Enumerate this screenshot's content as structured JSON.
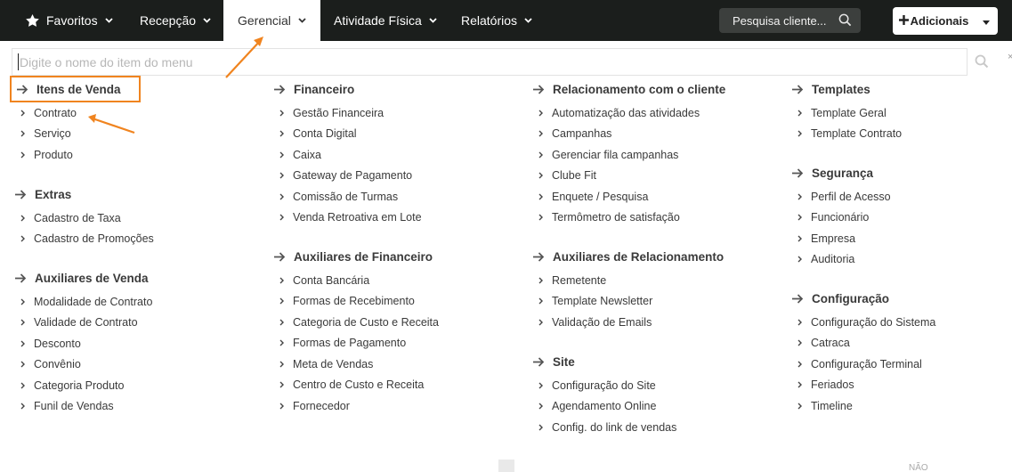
{
  "nav": {
    "favoritos": "Favoritos",
    "recepcao": "Recepção",
    "gerencial": "Gerencial",
    "atividade": "Atividade Física",
    "relatorios": "Relatórios",
    "search_label": "Pesquisa cliente...",
    "add_label": "Adicionais"
  },
  "menu_search": {
    "placeholder": "Digite o nome do item do menu"
  },
  "columns": [
    {
      "sections": [
        {
          "title": "Itens de Venda",
          "highlighted": true,
          "items": [
            "Contrato",
            "Serviço",
            "Produto"
          ]
        },
        {
          "title": "Extras",
          "items": [
            "Cadastro de Taxa",
            "Cadastro de Promoções"
          ]
        },
        {
          "title": "Auxiliares de Venda",
          "items": [
            "Modalidade de Contrato",
            "Validade de Contrato",
            "Desconto",
            "Convênio",
            "Categoria Produto",
            "Funil de Vendas"
          ]
        }
      ]
    },
    {
      "sections": [
        {
          "title": "Financeiro",
          "items": [
            "Gestão Financeira",
            "Conta Digital",
            "Caixa",
            "Gateway de Pagamento",
            "Comissão de Turmas",
            "Venda Retroativa em Lote"
          ]
        },
        {
          "title": "Auxiliares de Financeiro",
          "items": [
            "Conta Bancária",
            "Formas de Recebimento",
            "Categoria de Custo e Receita",
            "Formas de Pagamento",
            "Meta de Vendas",
            "Centro de Custo e Receita",
            "Fornecedor"
          ]
        }
      ]
    },
    {
      "sections": [
        {
          "title": "Relacionamento com o cliente",
          "items": [
            "Automatização das atividades",
            "Campanhas",
            "Gerenciar fila campanhas",
            "Clube Fit",
            "Enquete / Pesquisa",
            "Termômetro de satisfação"
          ]
        },
        {
          "title": "Auxiliares de Relacionamento",
          "items": [
            "Remetente",
            "Template Newsletter",
            "Validação de Emails"
          ]
        },
        {
          "title": "Site",
          "items": [
            "Configuração do Site",
            "Agendamento Online",
            "Config. do link de vendas"
          ]
        }
      ]
    },
    {
      "sections": [
        {
          "title": "Templates",
          "items": [
            "Template Geral",
            "Template Contrato"
          ]
        },
        {
          "title": "Segurança",
          "items": [
            "Perfil de Acesso",
            "Funcionário",
            "Empresa",
            "Auditoria"
          ]
        },
        {
          "title": "Configuração",
          "items": [
            "Configuração do Sistema",
            "Catraca",
            "Configuração Terminal",
            "Feriados",
            "Timeline"
          ]
        }
      ]
    }
  ],
  "footer_fragment": "NÃO",
  "colors": {
    "topbar": "#1b1e1c",
    "highlight": "#f0841f",
    "search_pill": "#3c3f3d"
  }
}
